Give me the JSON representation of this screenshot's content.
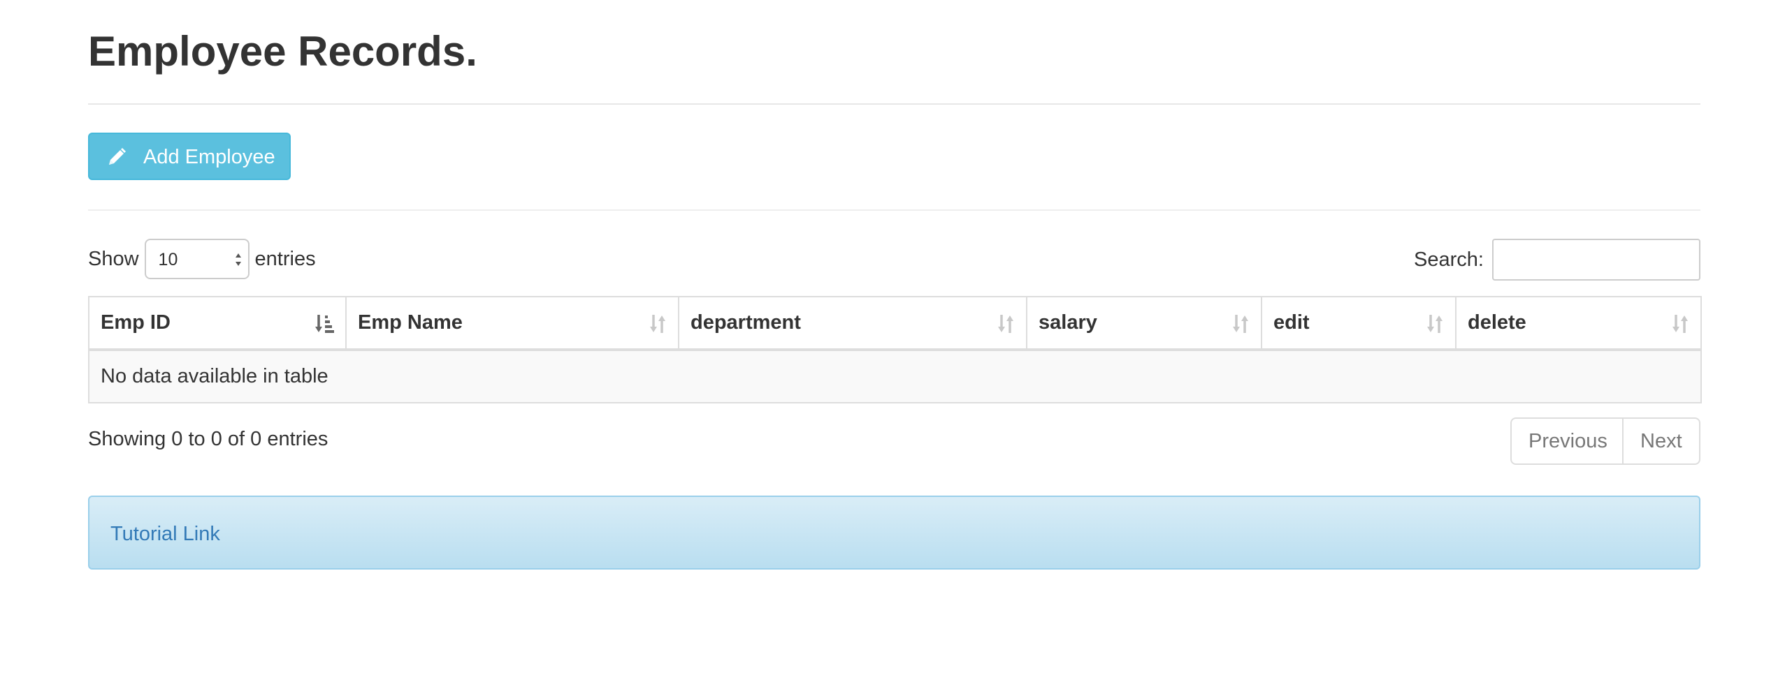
{
  "page": {
    "title": "Employee Records."
  },
  "toolbar": {
    "add_label": "Add Employee",
    "add_icon": "pencil-icon"
  },
  "table_controls": {
    "show_label": "Show",
    "entries_label": "entries",
    "page_length": "10",
    "search_label": "Search:",
    "search_value": ""
  },
  "table": {
    "columns": [
      {
        "label": "Emp ID",
        "sort": "ascending"
      },
      {
        "label": "Emp Name",
        "sort": "none"
      },
      {
        "label": "department",
        "sort": "none"
      },
      {
        "label": "salary",
        "sort": "none"
      },
      {
        "label": "edit",
        "sort": "none"
      },
      {
        "label": "delete",
        "sort": "none"
      }
    ],
    "empty_message": "No data available in table"
  },
  "footer": {
    "info": "Showing 0 to 0 of 0 entries",
    "previous_label": "Previous",
    "next_label": "Next"
  },
  "tutorial": {
    "link_label": "Tutorial Link"
  },
  "colors": {
    "info_button": "#5bc0de",
    "link": "#337ab7",
    "alert_bg": "#d9edf7"
  }
}
